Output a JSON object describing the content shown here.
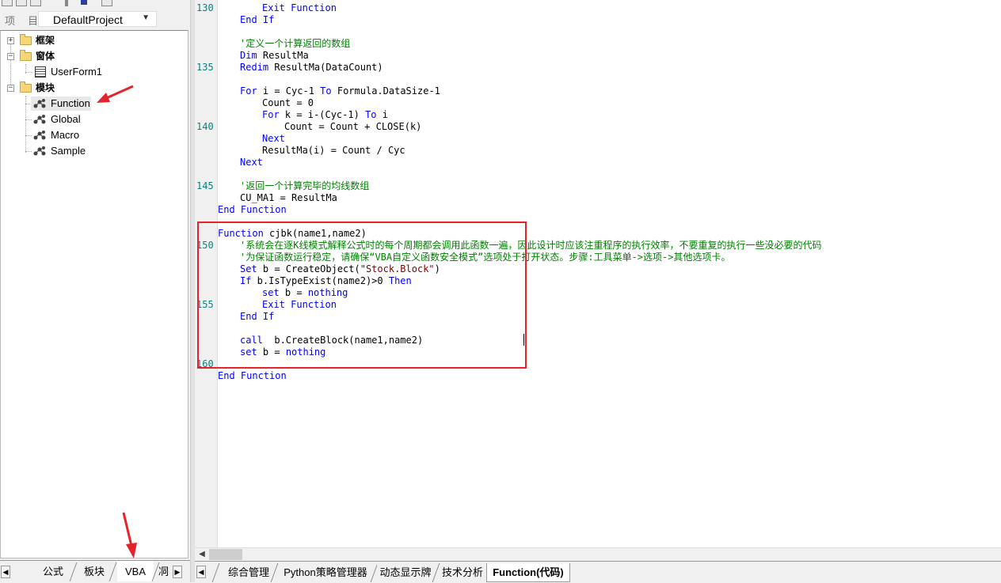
{
  "project": {
    "label": "项 目",
    "value": "DefaultProject"
  },
  "tree": {
    "framework": "框架",
    "windows": "窗体",
    "userform": "UserForm1",
    "modules": "模块",
    "items": [
      "Function",
      "Global",
      "Macro",
      "Sample"
    ]
  },
  "left_tabs": [
    "公式",
    "板块",
    "VBA",
    "㓊"
  ],
  "bottom_tabs": [
    "综合管理",
    "Python策略管理器",
    "动态显示牌",
    "技术分析",
    "Function(代码)"
  ],
  "line_numbers": [
    "130",
    "135",
    "140",
    "145",
    "150",
    "155",
    "160"
  ],
  "code": {
    "l130": "Exit Function",
    "l131": "End If",
    "l133": "'定义一个计算返回的数组",
    "l134a": "Dim",
    "l134b": " ResultMa",
    "l135a": "Redim",
    "l135b": " ResultMa(DataCount)",
    "l137a": "For",
    "l137b": " i = Cyc-1 ",
    "l137c": "To",
    "l137d": " Formula.DataSize-1",
    "l138": "Count = 0",
    "l139a": "For",
    "l139b": " k = i-(Cyc-1) ",
    "l139c": "To",
    "l139d": " i",
    "l140": "Count = Count + CLOSE(k)",
    "l141": "Next",
    "l142": "ResultMa(i) = Count / Cyc",
    "l143": "Next",
    "l145": "'返回一个计算完毕的均线数组",
    "l146": "CU_MA1 = ResultMa",
    "l147": "End Function",
    "l149": "Function cjbk(name1,name2)",
    "l150": "'系统会在逐K线模式解释公式时的每个周期都会调用此函数一遍，因此设计时应该注重程序的执行效率，不要重复的执行一些没必要的代码",
    "l151": "'为保证函数运行稳定，请确保“VBA自定义函数安全模式”选项处于打开状态。步骤:工具菜单->选项->其他选项卡。",
    "l152a": "Set",
    "l152b": " b = CreateObject(",
    "l152c": "\"Stock.Block\"",
    "l152d": ")",
    "l153a": "If",
    "l153b": " b.IsTypeExist(name2)>0 ",
    "l153c": "Then",
    "l154a": "set",
    "l154b": " b = ",
    "l154c": "nothing",
    "l155": "Exit Function",
    "l156": "End If",
    "l158a": "call",
    "l158b": "  b.CreateBlock(name1,name2)",
    "l159a": "set",
    "l159b": " b = ",
    "l159c": "nothing",
    "l161": "End Function"
  },
  "colors": {
    "keyword": "#0000ff",
    "comment": "#008000",
    "string": "#800000",
    "highlight_box": "#e4232a",
    "line_number": "#0d8080"
  }
}
